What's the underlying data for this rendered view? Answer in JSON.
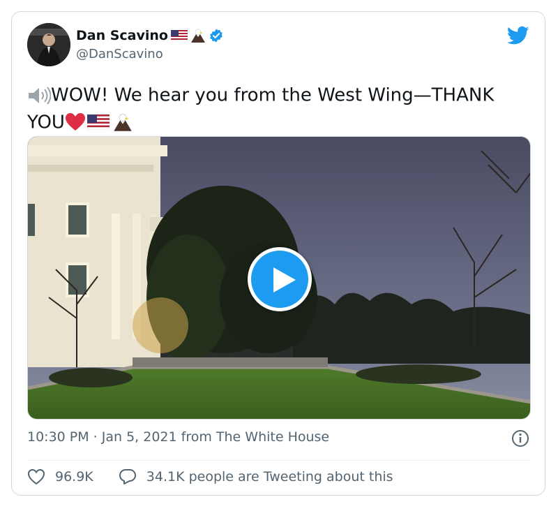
{
  "author": {
    "display_name": "Dan Scavino",
    "handle": "@DanScavino",
    "verified": true
  },
  "tweet": {
    "text_line1": "WOW! We hear you from the West Wing—THANK",
    "text_line2": "YOU",
    "timestamp": "10:30 PM · Jan 5, 2021 from The White House"
  },
  "stats": {
    "likes": "96.9K",
    "tweeting": "34.1K people are Tweeting about this"
  },
  "icons": [
    "speaker-icon",
    "heart-icon",
    "flag-icon",
    "eagle-icon",
    "verified-icon",
    "twitter-bird-icon",
    "play-icon",
    "info-icon",
    "like-icon",
    "reply-icon"
  ],
  "colors": {
    "accent": "#1d9bf0",
    "text": "#0f1419",
    "secondary": "#536471",
    "border": "#cfd9de",
    "heart": "#e0245e"
  }
}
